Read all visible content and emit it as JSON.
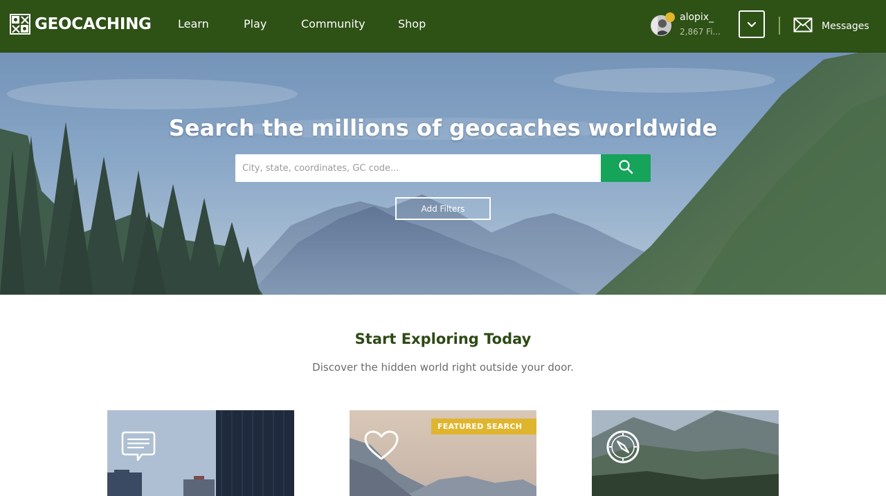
{
  "header": {
    "logo_text": "GEOCACHING",
    "nav": [
      {
        "label": "Learn"
      },
      {
        "label": "Play"
      },
      {
        "label": "Community"
      },
      {
        "label": "Shop"
      }
    ],
    "user": {
      "name": "alopix_",
      "finds": "2,867 Fi..."
    },
    "messages_label": "Messages"
  },
  "hero": {
    "title": "Search the millions of geocaches worldwide",
    "search_placeholder": "City, state, coordinates, GC code...",
    "filters_label": "Add Filters"
  },
  "explore": {
    "title": "Start Exploring Today",
    "subtitle": "Discover the hidden world right outside your door.",
    "cards": [
      {
        "icon": "chat-bubble-icon"
      },
      {
        "icon": "heart-icon",
        "badge": "FEATURED SEARCH"
      },
      {
        "icon": "compass-icon"
      }
    ]
  },
  "colors": {
    "header_bg": "#2e5116",
    "search_button": "#16a35a",
    "badge": "#e0b52e",
    "section_title": "#2e4a16"
  }
}
